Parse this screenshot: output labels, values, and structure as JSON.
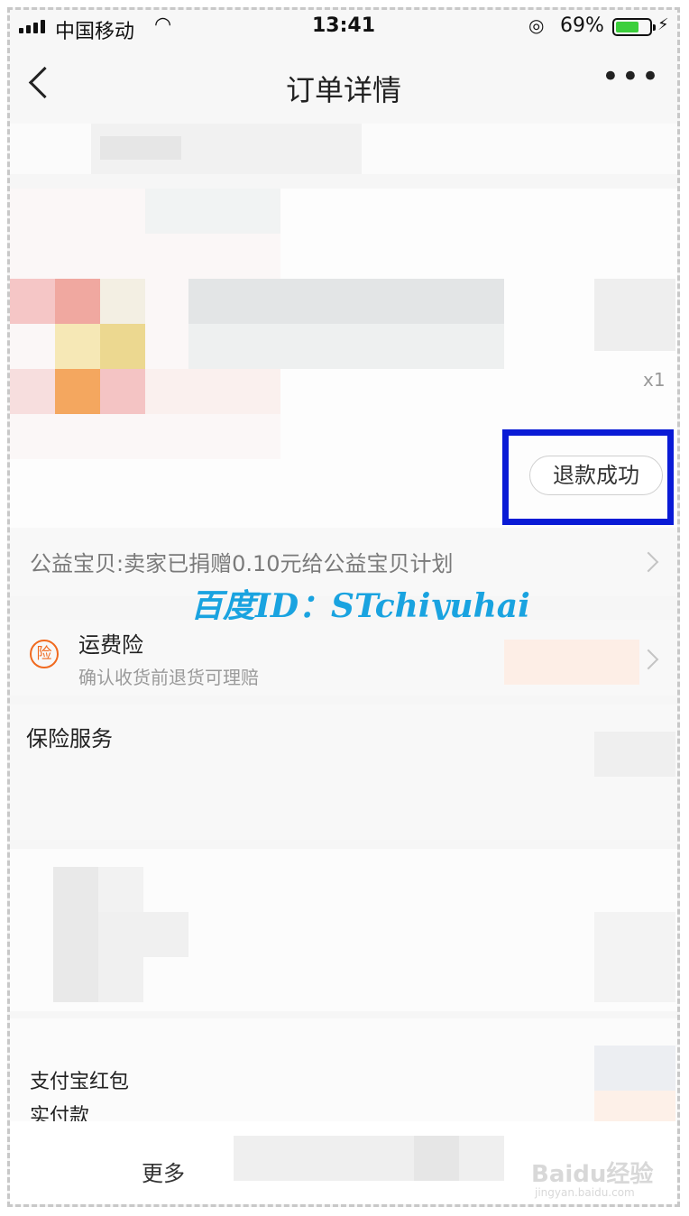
{
  "status_bar": {
    "carrier": "中国移动",
    "wifi_icon": "wifi-icon",
    "time": "13:41",
    "orientation_lock_icon": "orientation-lock-icon",
    "battery_percent": "69%",
    "battery_level": 0.69,
    "charging_icon": "bolt-icon"
  },
  "nav": {
    "back_icon": "chevron-left-icon",
    "title": "订单详情",
    "more_icon": "more-dots-icon",
    "more_glyph": "•••"
  },
  "item": {
    "quantity": "x1",
    "refund_button": "退款成功"
  },
  "charity": {
    "text": "公益宝贝:卖家已捐赠0.10元给公益宝贝计划"
  },
  "watermark": {
    "text": "百度ID：STchiyuhai"
  },
  "insurance": {
    "icon_char": "险",
    "title": "运费险",
    "subtitle": "确认收货前退货可理赔"
  },
  "services": {
    "title": "保险服务"
  },
  "payment": {
    "red_packet_label": "支付宝红包",
    "paid_label": "实付款"
  },
  "bottom": {
    "more_label": "更多"
  },
  "brand_watermark": {
    "text": "Baidu经验",
    "sub": "jingyan.baidu.com"
  },
  "colors": {
    "highlight_box": "#0a1bd6",
    "insurance_orange": "#f06a1f",
    "watermark_blue": "#19a3e0",
    "battery_green": "#3ccf3c"
  }
}
